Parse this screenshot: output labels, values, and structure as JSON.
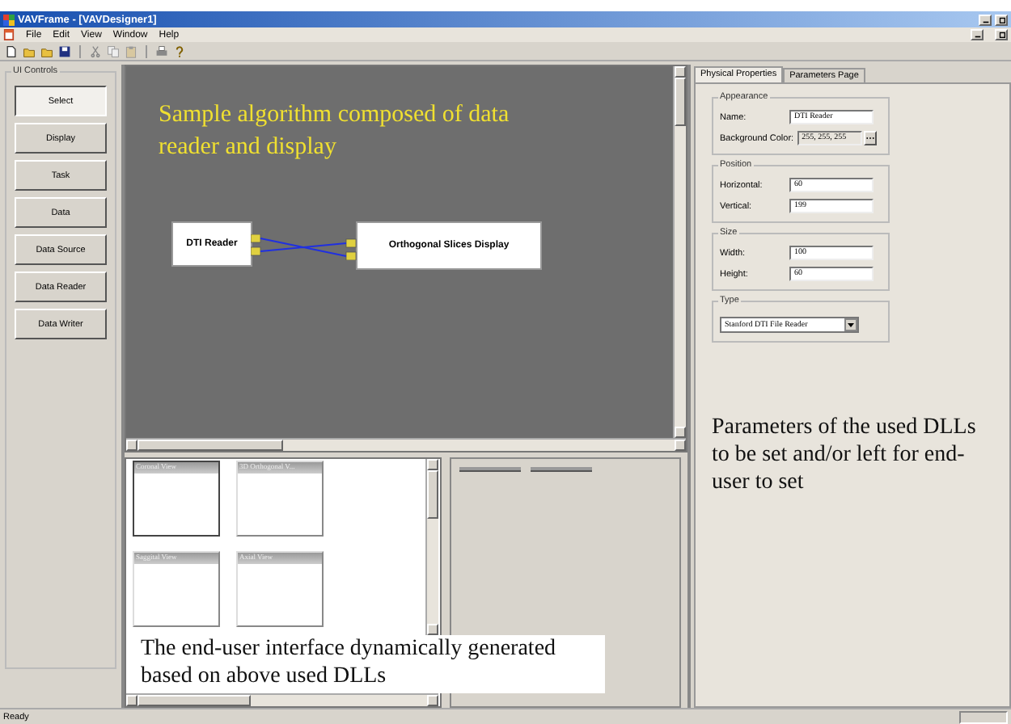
{
  "window": {
    "title": "VAVFrame - [VAVDesigner1]"
  },
  "menu": [
    "File",
    "Edit",
    "View",
    "Window",
    "Help"
  ],
  "ui_controls": {
    "title": "UI Controls",
    "buttons": [
      {
        "label": "Select",
        "selected": true
      },
      {
        "label": "Display",
        "selected": false
      },
      {
        "label": "Task",
        "selected": false
      },
      {
        "label": "Data",
        "selected": false
      },
      {
        "label": "Data Source",
        "selected": false
      },
      {
        "label": "Data Reader",
        "selected": false
      },
      {
        "label": "Data Writer",
        "selected": false
      }
    ]
  },
  "canvas": {
    "caption": "Sample algorithm composed of data reader and display",
    "nodes": [
      {
        "label": "DTI Reader",
        "kind": "source"
      },
      {
        "label": "Orthogonal Slices Display",
        "kind": "sink"
      }
    ]
  },
  "views": [
    {
      "title": "Coronal View",
      "selected": true
    },
    {
      "title": "3D Orthogonal V...",
      "selected": false
    },
    {
      "title": "Saggital View",
      "selected": false
    },
    {
      "title": "Axial View",
      "selected": false
    }
  ],
  "views_caption": "The end-user interface dynamically generated based on above used DLLs",
  "properties": {
    "tabs": [
      {
        "label": "Physical Properties",
        "selected": true
      },
      {
        "label": "Parameters Page",
        "selected": false
      }
    ],
    "groups": [
      {
        "title": "Appearance",
        "fields": [
          {
            "label": "Name:",
            "value": "DTI Reader",
            "kind": "text"
          },
          {
            "label": "Background Color:",
            "value": "255, 255, 255",
            "kind": "color"
          }
        ]
      },
      {
        "title": "Position",
        "fields": [
          {
            "label": "Horizontal:",
            "value": "60",
            "kind": "text"
          },
          {
            "label": "Vertical:",
            "value": "199",
            "kind": "text"
          }
        ]
      },
      {
        "title": "Size",
        "fields": [
          {
            "label": "Width:",
            "value": "100",
            "kind": "text"
          },
          {
            "label": "Height:",
            "value": "60",
            "kind": "text"
          }
        ]
      },
      {
        "title": "Type",
        "fields": [
          {
            "value": "Stanford DTI File Reader",
            "kind": "dropdown"
          }
        ]
      }
    ],
    "caption": "Parameters of the used DLLs to be set and/or left for end-user to set"
  },
  "status_bar": "Ready"
}
